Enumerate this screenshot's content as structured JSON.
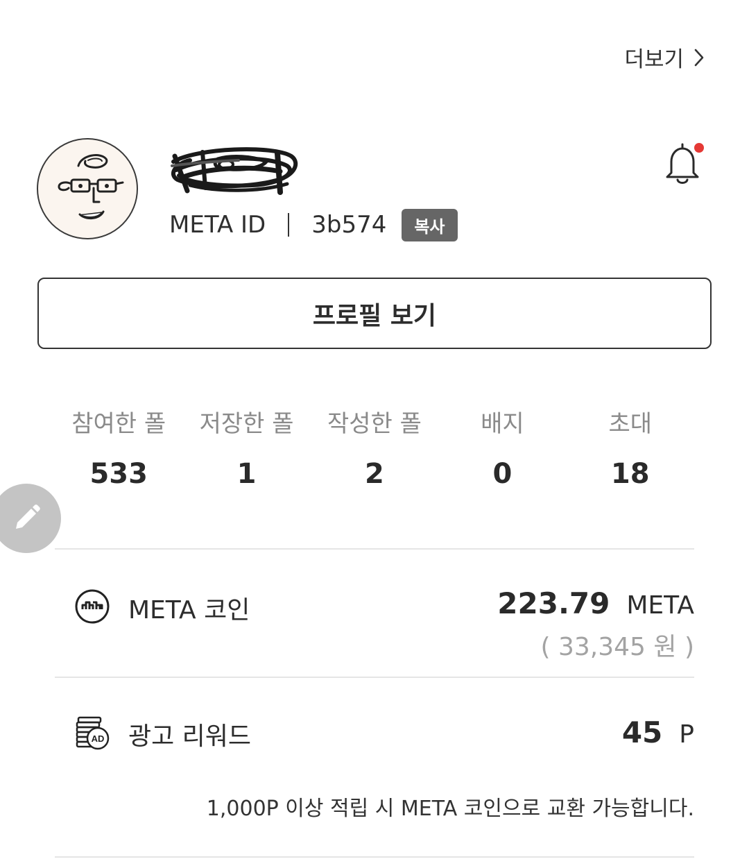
{
  "header": {
    "more_label": "더보기",
    "more_icon": "chevron-right-icon"
  },
  "profile": {
    "avatar_icon": "cartoon-face-avatar",
    "username_redacted": true,
    "meta_id_label": "META ID",
    "meta_id_value": "3b574",
    "copy_label": "복사",
    "notification_icon": "bell-icon",
    "notification_dot_color": "#e53935",
    "view_profile_label": "프로필 보기"
  },
  "stats": [
    {
      "label": "참여한 폴",
      "value": "533"
    },
    {
      "label": "저장한 폴",
      "value": "1"
    },
    {
      "label": "작성한 폴",
      "value": "2"
    },
    {
      "label": "배지",
      "value": "0"
    },
    {
      "label": "초대",
      "value": "18"
    }
  ],
  "fab": {
    "icon": "pencil-icon"
  },
  "coin": {
    "icon": "meta-coin-icon",
    "label": "META 코인",
    "value": "223.79",
    "unit": "META",
    "krw": "( 33,345 원 )"
  },
  "reward": {
    "icon": "ad-coins-icon",
    "label": "광고 리워드",
    "value": "45",
    "unit": "P",
    "note": "1,000P 이상 적립 시 META 코인으로 교환 가능합니다."
  },
  "colors": {
    "text_primary": "#2b2b2b",
    "text_muted": "#8a8a8a",
    "badge_bg": "#666666",
    "divider": "#e5e5e5",
    "fab_bg": "#c4c4c4"
  }
}
